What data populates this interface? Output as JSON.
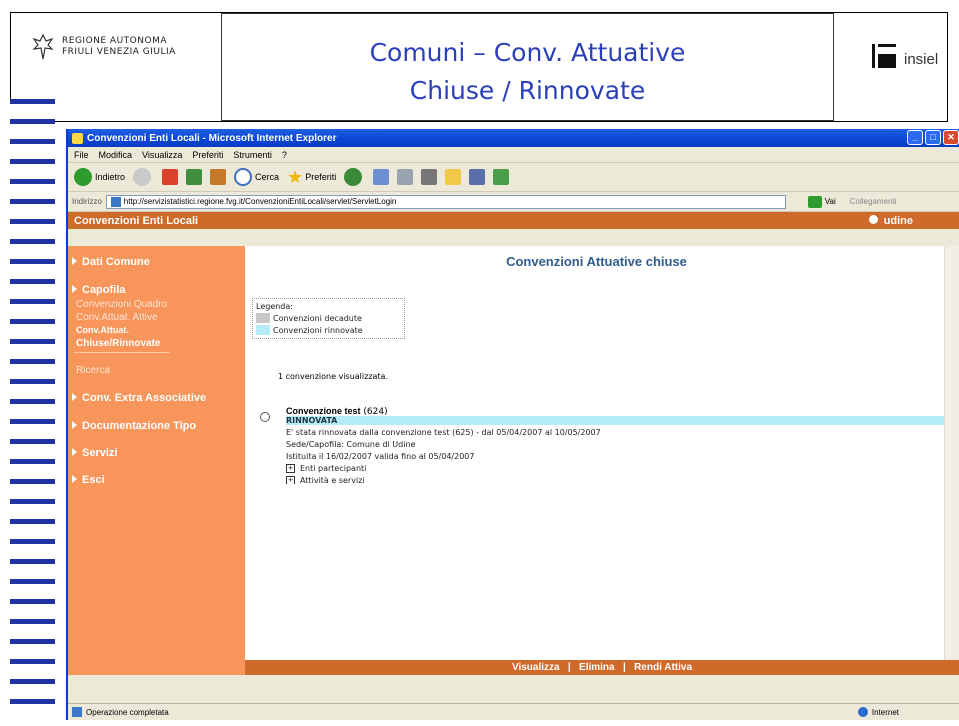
{
  "slide": {
    "logo_left_line1": "REGIONE AUTONOMA",
    "logo_left_line2": "FRIULI VENEZIA GIULIA",
    "title_line1": "Comuni – Conv. Attuative",
    "title_line2": "Chiuse / Rinnovate",
    "logo_right_text": "insiel"
  },
  "window": {
    "title": "Convenzioni Enti Locali - Microsoft Internet Explorer",
    "menu": [
      "File",
      "Modifica",
      "Visualizza",
      "Preferiti",
      "Strumenti",
      "?"
    ],
    "toolbar": {
      "back": "Indietro",
      "search": "Cerca",
      "favorites": "Preferiti"
    },
    "address_label": "Indirizzo",
    "address_url": "http://servizistatistici.regione.fvg.it/ConvenzioniEntiLocali/servlet/ServletLogin",
    "go_label": "Vai",
    "links_label": "Collegamenti"
  },
  "app": {
    "header_title": "Convenzioni Enti Locali",
    "user": "udine"
  },
  "sidebar": {
    "dati_comune": "Dati Comune",
    "capofila": "Capofila",
    "conv_quadro": "Convenzioni Quadro",
    "conv_attive": "Conv.Attuat. Attive",
    "conv_chiuse_1": "Conv.Attuat.",
    "conv_chiuse_2": "Chiuse/Rinnovate",
    "ricerca": "Ricerca",
    "conv_extra": "Conv. Extra Associative",
    "documentazione": "Documentazione Tipo",
    "servizi": "Servizi",
    "esci": "Esci"
  },
  "content": {
    "title": "Convenzioni Attuative chiuse",
    "legend_title": "Legenda:",
    "legend_decadute": "Convenzioni decadute",
    "legend_rinnovate": "Convenzioni rinnovate",
    "count_text": "1 convenzione visualizzata.",
    "conv_name": "Convenzione test",
    "conv_id": "(624)",
    "conv_status": "RINNOVATA",
    "conv_line1": "E' stata rinnovata dalla convenzione test (625) - dal 05/04/2007 al 10/05/2007",
    "conv_line2": "Sede/Capofila: Comune di Udine",
    "conv_line3": "Istituita il 16/02/2007 valida fino al 05/04/2007",
    "conv_enti": "Enti partecipanti",
    "conv_attivita": "Attività e servizi"
  },
  "bottombar": "Visualizza   |   Elimina   |   Rendi Attiva",
  "status": {
    "left": "Operazione completata",
    "zone": "Internet"
  },
  "colors": {
    "accent_blue": "#2133a4",
    "orange": "#cf6a2b",
    "sidebar": "#f7955a",
    "legend_decadute": "#c8c8c8",
    "legend_rinnovate": "#b4ecf5"
  }
}
